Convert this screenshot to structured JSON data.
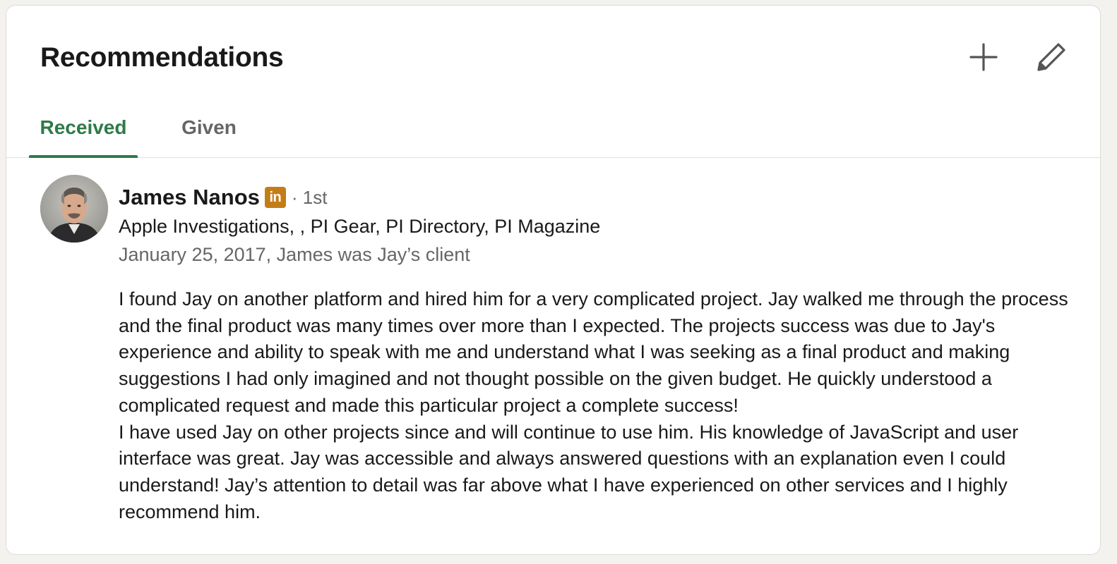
{
  "section": {
    "title": "Recommendations",
    "add_icon": "plus-icon",
    "edit_icon": "pencil-icon"
  },
  "tabs": [
    {
      "label": "Received",
      "active": true
    },
    {
      "label": "Given",
      "active": false
    }
  ],
  "recommendation": {
    "name": "James Nanos",
    "badge": "in",
    "degree": "· 1st",
    "headline": "Apple Investigations, , PI Gear, PI Directory, PI Magazine",
    "meta": "January 25, 2017, James was Jay’s client",
    "paragraphs": [
      "I found Jay on another platform and hired him for a very complicated project. Jay walked me through the process and the final product was many times over more than I expected. The projects success was due to Jay's experience and ability to speak with me and understand what I was seeking as a final product and making suggestions I had only imagined and not thought possible on the given budget. He quickly understood a complicated request and made this particular project a complete success!",
      "I have used Jay on other projects since and will continue to use him. His knowledge of JavaScript and user interface was great. Jay was accessible and always answered questions with an explanation even I could understand! Jay’s attention to detail was far above what I have experienced on other services and I highly recommend him."
    ]
  },
  "colors": {
    "accent": "#2e7a47",
    "badge": "#c37d16",
    "muted_text": "#666666",
    "text": "#191919"
  }
}
